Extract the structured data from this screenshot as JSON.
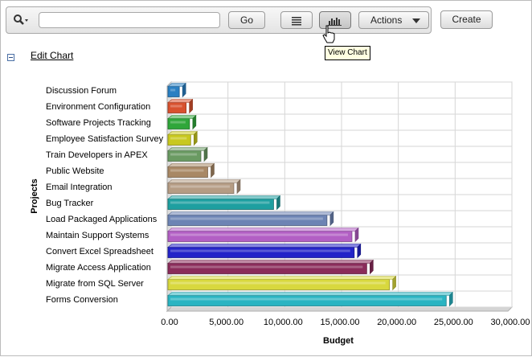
{
  "toolbar": {
    "search_icon": "search-icon",
    "search_value": "",
    "go_label": "Go",
    "list_view_icon": "list-view-icon",
    "chart_view_icon": "bar-chart-icon",
    "actions_label": "Actions",
    "create_label": "Create"
  },
  "tooltip": "View Chart",
  "edit_chart_label": "Edit Chart",
  "chart_data": {
    "type": "bar",
    "orientation": "horizontal",
    "categories": [
      "Discussion Forum",
      "Environment Configuration",
      "Software Projects Tracking",
      "Employee Satisfaction Survey",
      "Train Developers in APEX",
      "Public Website",
      "Email Integration",
      "Bug Tracker",
      "Load Packaged Applications",
      "Maintain Support Systems",
      "Convert Excel Spreadsheet",
      "Migrate Access Application",
      "Migrate from SQL Server",
      "Forms Conversion"
    ],
    "values": [
      1000,
      1600,
      1900,
      2000,
      2900,
      3500,
      5800,
      9300,
      14000,
      16200,
      16400,
      17500,
      19500,
      24500
    ],
    "bar_colors": [
      "#2a7fc2",
      "#d8512e",
      "#2fa63a",
      "#c8c81e",
      "#6a9a62",
      "#a88865",
      "#b59c84",
      "#1e9fa0",
      "#6d84b4",
      "#b25fc4",
      "#2323c8",
      "#8a2b5a",
      "#d8d83e",
      "#2ab4c2"
    ],
    "xlabel": "Budget",
    "ylabel": "Projects",
    "xlim": [
      0,
      30000
    ],
    "xticks": [
      "0.00",
      "5,000.00",
      "10,000.00",
      "15,000.00",
      "20,000.00",
      "25,000.00",
      "30,000.00"
    ],
    "grid": true
  }
}
